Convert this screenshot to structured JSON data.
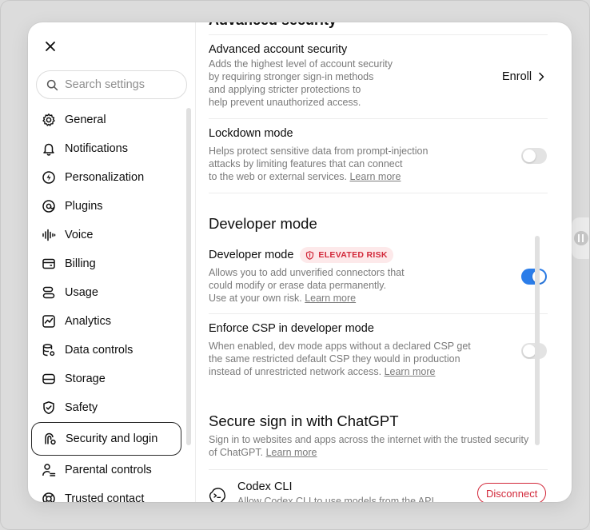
{
  "sidebar": {
    "search_placeholder": "Search settings",
    "items": [
      {
        "label": "General",
        "icon": "gear-icon"
      },
      {
        "label": "Notifications",
        "icon": "bell-icon"
      },
      {
        "label": "Personalization",
        "icon": "personalization-icon"
      },
      {
        "label": "Plugins",
        "icon": "plugins-icon"
      },
      {
        "label": "Voice",
        "icon": "voice-wave-icon"
      },
      {
        "label": "Billing",
        "icon": "card-icon"
      },
      {
        "label": "Usage",
        "icon": "usage-icon"
      },
      {
        "label": "Analytics",
        "icon": "analytics-icon"
      },
      {
        "label": "Data controls",
        "icon": "database-gear-icon"
      },
      {
        "label": "Storage",
        "icon": "storage-icon"
      },
      {
        "label": "Safety",
        "icon": "shield-check-icon"
      },
      {
        "label": "Security and login",
        "icon": "security-icon",
        "active": true
      },
      {
        "label": "Parental controls",
        "icon": "parental-icon"
      },
      {
        "label": "Trusted contact",
        "icon": "lifebuoy-icon"
      }
    ]
  },
  "main": {
    "cut_heading": "Advanced security",
    "advanced_account": {
      "title": "Advanced account security",
      "desc_lines": [
        "Adds the highest level of account security",
        "by requiring stronger sign-in methods",
        "and applying stricter protections to",
        "help prevent unauthorized access."
      ],
      "action": "Enroll"
    },
    "lockdown": {
      "title": "Lockdown mode",
      "desc_lines": [
        "Helps protect sensitive data from prompt-injection",
        "attacks by limiting features that can connect",
        "to the web or external services."
      ],
      "link": "Learn more",
      "enabled": false
    },
    "developer_section": "Developer mode",
    "developer_mode": {
      "title": "Developer mode",
      "badge": "ELEVATED RISK",
      "desc_lines": [
        "Allows you to add unverified connectors that",
        "could modify or erase data permanently.",
        "Use at your own risk."
      ],
      "link": "Learn more",
      "enabled": true
    },
    "enforce_csp": {
      "title": "Enforce CSP in developer mode",
      "desc_lines": [
        "When enabled, dev mode apps without a declared CSP get",
        "the same restricted default CSP they would in production",
        "instead of unrestricted network access."
      ],
      "link": "Learn more",
      "enabled": false
    },
    "secure_section": "Secure sign in with ChatGPT",
    "secure_desc_lines": [
      "Sign in to websites and apps across the internet with the trusted security",
      "of ChatGPT."
    ],
    "secure_link": "Learn more",
    "codex": {
      "title": "Codex CLI",
      "desc": "Allow Codex CLI to use models from the API",
      "action": "Disconnect"
    }
  },
  "colors": {
    "accent": "#2b7de9",
    "danger": "#d2283a",
    "badge_bg": "#fde9ea"
  }
}
